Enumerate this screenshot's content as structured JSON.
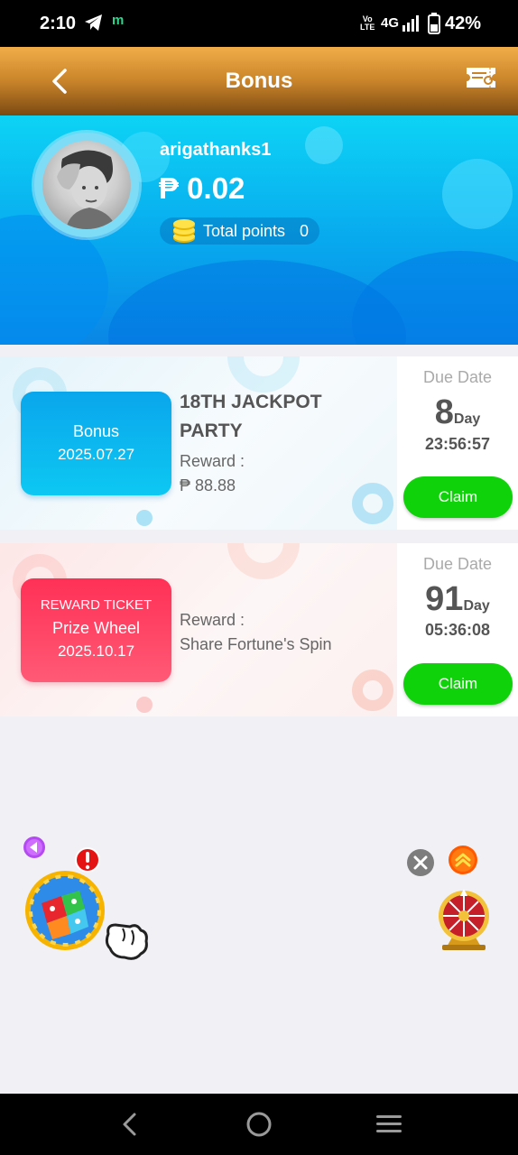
{
  "status_bar": {
    "time": "2:10",
    "notif_m": "m",
    "volte_top": "Vo",
    "volte_bottom": "LTE",
    "network": "4G",
    "battery": "42%"
  },
  "header": {
    "title": "Bonus",
    "back_icon": "chevron-left-icon",
    "ticket_icon": "ticket-icon",
    "gradient_top": "#f1ad48",
    "gradient_bottom": "#7b4a12"
  },
  "profile": {
    "username": "arigathanks1",
    "balance": "₱ 0.02",
    "points_label": "Total points",
    "points_value": "0",
    "banner_color": "#08a9ee"
  },
  "cards": [
    {
      "badge_line1": "Bonus",
      "badge_line2": "2025.07.27",
      "title": "18TH JACKPOT PARTY",
      "title_line1": "18TH JACKPOT",
      "title_line2": "PARTY",
      "reward_label": "Reward :",
      "reward_value": "₱ 88.88",
      "due_label": "Due Date",
      "due_days": "8",
      "due_unit": "Day",
      "due_time": "23:56:57",
      "claim_label": "Claim",
      "badge_color": "#0aa6ec"
    },
    {
      "badge_line1": "REWARD TICKET",
      "badge_line2": "Prize Wheel",
      "badge_line3": "2025.10.17",
      "reward_label": "Reward :",
      "reward_value": "Share Fortune's Spin",
      "due_label": "Due Date",
      "due_days": "91",
      "due_unit": "Day",
      "due_time": "05:36:08",
      "claim_label": "Claim",
      "badge_color": "#ff3d66"
    }
  ],
  "floating": {
    "left_arrow_icon": "play-left-icon",
    "alert_badge": "!",
    "dice_icon": "dice-ball-icon",
    "pointer_icon": "pointing-hand-icon",
    "close_icon": "close-icon",
    "scroll_up_icon": "double-chevron-up-icon",
    "wheel_icon": "prize-wheel-icon"
  },
  "nav": {
    "back_icon": "nav-back-icon",
    "home_icon": "nav-home-icon",
    "menu_icon": "nav-menu-icon"
  },
  "colors": {
    "claim_green": "#10d20b",
    "accent_orange": "#f1ad48"
  }
}
